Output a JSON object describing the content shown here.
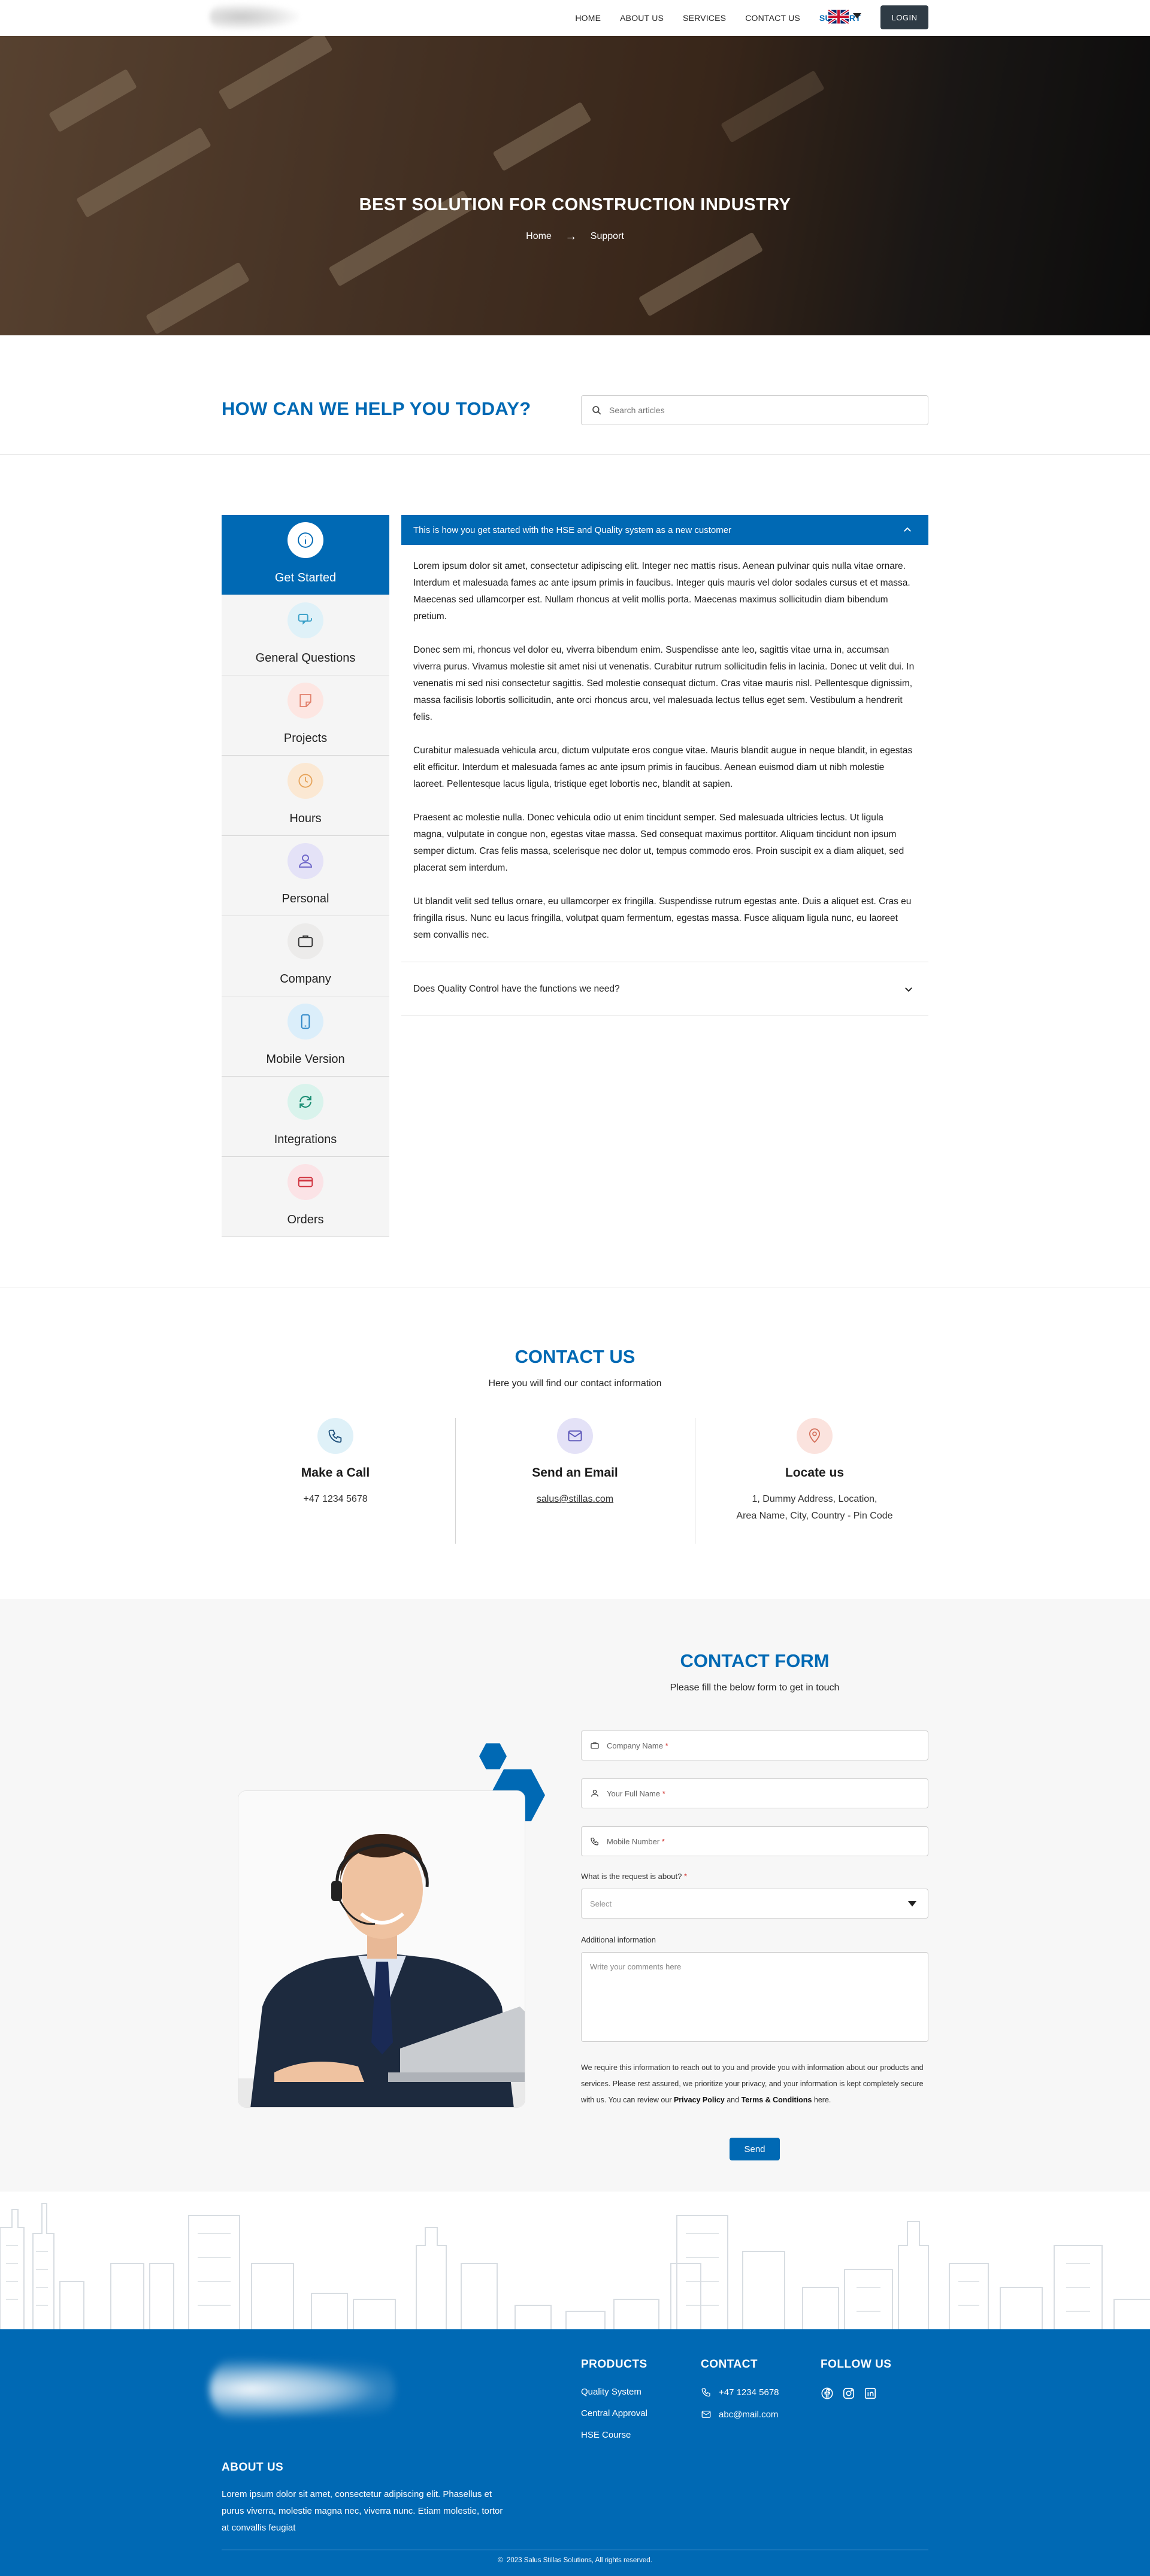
{
  "nav": {
    "items": [
      {
        "label": "HOME"
      },
      {
        "label": "ABOUT US"
      },
      {
        "label": "SERVICES"
      },
      {
        "label": "CONTACT US"
      },
      {
        "label": "SUPPORT",
        "active": true
      }
    ],
    "login_label": "LOGIN",
    "language_icon": "uk-flag-icon"
  },
  "hero": {
    "title": "BEST SOLUTION FOR CONSTRUCTION INDUSTRY",
    "breadcrumb": [
      "Home",
      "Support"
    ]
  },
  "help": {
    "title": "HOW CAN WE HELP YOU TODAY?",
    "search_placeholder": "Search articles"
  },
  "categories": [
    {
      "label": "Get Started",
      "icon": "info-icon",
      "active": true
    },
    {
      "label": "General Questions",
      "icon": "chat-icon"
    },
    {
      "label": "Projects",
      "icon": "note-icon"
    },
    {
      "label": "Hours",
      "icon": "clock-icon"
    },
    {
      "label": "Personal",
      "icon": "user-icon"
    },
    {
      "label": "Company",
      "icon": "briefcase-icon"
    },
    {
      "label": "Mobile Version",
      "icon": "mobile-icon"
    },
    {
      "label": "Integrations",
      "icon": "sync-icon"
    },
    {
      "label": "Orders",
      "icon": "card-icon"
    }
  ],
  "faq": {
    "open_question": "This is how you get started with the HSE and Quality system as a new customer",
    "paragraphs": [
      "Lorem ipsum dolor sit amet, consectetur adipiscing elit. Integer nec mattis risus. Aenean pulvinar quis nulla vitae ornare. Interdum et malesuada fames ac ante ipsum primis in faucibus. Integer quis mauris vel dolor sodales cursus et et massa. Maecenas sed ullamcorper est. Nullam rhoncus at velit mollis porta. Maecenas maximus sollicitudin diam bibendum pretium.",
      "Donec sem mi, rhoncus vel dolor eu, viverra bibendum enim. Suspendisse ante leo, sagittis vitae urna in, accumsan viverra purus. Vivamus molestie sit amet nisi ut venenatis. Curabitur rutrum sollicitudin felis in lacinia. Donec ut velit dui. In venenatis mi sed nisi consectetur sagittis. Sed molestie consequat dictum. Cras vitae mauris nisl. Pellentesque dignissim, massa facilisis lobortis sollicitudin, ante orci rhoncus arcu, vel malesuada lectus tellus eget sem. Vestibulum a hendrerit felis.",
      "Curabitur malesuada vehicula arcu, dictum vulputate eros congue vitae. Mauris blandit augue in neque blandit, in egestas elit efficitur. Interdum et malesuada fames ac ante ipsum primis in faucibus. Aenean euismod diam ut nibh molestie laoreet. Pellentesque lacus ligula, tristique eget lobortis nec, blandit at sapien.",
      "Praesent ac molestie nulla. Donec vehicula odio ut enim tincidunt semper. Sed malesuada ultricies lectus. Ut ligula magna, vulputate in congue non, egestas vitae massa. Sed consequat maximus porttitor. Aliquam tincidunt non ipsum semper dictum. Cras felis massa, scelerisque nec dolor ut, tempus commodo eros. Proin suscipit ex a diam aliquet, sed placerat sem interdum.",
      "Ut blandit velit sed tellus ornare, eu ullamcorper ex fringilla. Suspendisse rutrum egestas ante. Duis a aliquet est. Cras eu fringilla risus. Nunc eu lacus fringilla, volutpat quam fermentum, egestas massa. Fusce aliquam ligula nunc, eu laoreet sem convallis nec."
    ],
    "closed_question": "Does Quality Control have the functions we need?"
  },
  "contact": {
    "title": "CONTACT US",
    "subtitle": "Here you will find our contact information",
    "call": {
      "title": "Make a Call",
      "value": "+47 1234 5678"
    },
    "email": {
      "title": "Send an Email",
      "value": "salus@stillas.com"
    },
    "locate": {
      "title": "Locate us",
      "line1": "1, Dummy Address, Location,",
      "line2": "Area Name, City, Country  - Pin Code"
    }
  },
  "form": {
    "title": "CONTACT FORM",
    "subtitle": "Please fill the below form to get in touch",
    "company_placeholder": "Company Name",
    "name_placeholder": "Your Full Name",
    "mobile_placeholder": "Mobile Number",
    "required_mark": "*",
    "request_label": "What is the request is about?",
    "select_placeholder": "Select",
    "additional_label": "Additional information",
    "comments_placeholder": "Write your comments here",
    "consent_text": "We require this information to reach out to you and provide you with information about our products and services. Please rest assured, we prioritize your privacy, and your information is kept completely secure with us. You can review our",
    "privacy_link": "Privacy Policy",
    "and": "and",
    "terms_link": "Terms & Conditions",
    "here": "here.",
    "send_label": "Send"
  },
  "footer": {
    "products_title": "PRODUCTS",
    "products": [
      "Quality System",
      "Central Approval",
      "HSE Course"
    ],
    "contact_title": "CONTACT",
    "phone": "+47 1234 5678",
    "email": "abc@mail.com",
    "follow_title": "FOLLOW US",
    "social_icons": [
      "facebook-icon",
      "instagram-icon",
      "linkedin-icon"
    ],
    "about_title": "ABOUT US",
    "about_text": "Lorem ipsum dolor sit amet, consectetur adipiscing elit. Phasellus et purus viverra, molestie magna nec, viverra nunc. Etiam molestie, tortor at convallis feugiat",
    "copyright": "2023 Salus Stillas Solutions, All rights reserved.",
    "copyright_symbol": "©"
  },
  "colors": {
    "brand_blue": "#0069b4",
    "dark_button": "#2f3b45",
    "required_red": "#d0312d"
  }
}
